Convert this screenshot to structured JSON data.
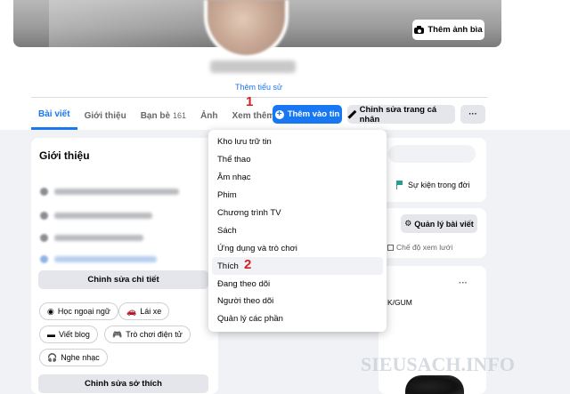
{
  "profile": {
    "cover_button": "Thêm ảnh bìa",
    "bio_link": "Thêm tiểu sử"
  },
  "nav": {
    "tabs": [
      {
        "label": "Bài viết",
        "active": true
      },
      {
        "label": "Giới thiệu"
      },
      {
        "label": "Bạn bè",
        "count": "161"
      },
      {
        "label": "Ảnh"
      },
      {
        "label": "Xem thêm"
      }
    ],
    "add_story": "Thêm vào tin",
    "edit_profile": "Chỉnh sửa trang cá nhân",
    "more": "···"
  },
  "markers": {
    "one": "1",
    "two": "2"
  },
  "intro": {
    "title": "Giới thiệu",
    "edit_details": "Chỉnh sửa chi tiết",
    "hobbies": [
      "Học ngoại ngữ",
      "Lái xe",
      "Viết blog",
      "Trò chơi điện tử",
      "Nghe nhạc"
    ],
    "edit_hobbies": "Chỉnh sửa sở thích"
  },
  "right": {
    "life_event": "Sự kiện trong đời",
    "manage_posts": "Quản lý bài viết",
    "grid_view": "Chế độ xem lưới",
    "post_text": "K/GUM",
    "post_menu": "···"
  },
  "dropdown": {
    "items": [
      "Kho lưu trữ tin",
      "Thể thao",
      "Âm nhạc",
      "Phim",
      "Chương trình TV",
      "Sách",
      "Ứng dụng và trò chơi",
      "Thích",
      "Đang theo dõi",
      "Người theo dõi",
      "Quản lý các phần"
    ],
    "highlighted": "Thích"
  },
  "watermark": "SIEUSACH.INFO",
  "colors": {
    "accent": "#1877f2",
    "marker": "#d42020"
  }
}
